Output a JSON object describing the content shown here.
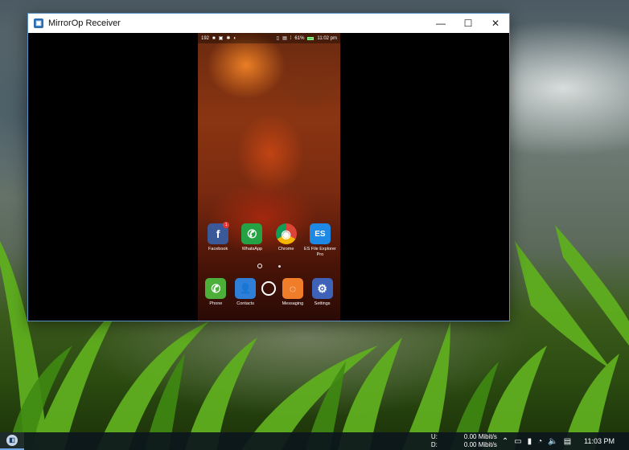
{
  "window": {
    "title": "MirrorOp Receiver",
    "controls": {
      "minimize": "—",
      "maximize": "☐",
      "close": "✕"
    }
  },
  "phone": {
    "status_bar": {
      "left_icons": [
        "192",
        "■",
        "▣",
        "✱",
        "◐"
      ],
      "right_icons": [
        "▯",
        "▤",
        "⁞"
      ],
      "battery": "61%",
      "time": "11:02 pm"
    },
    "apps": [
      {
        "label": "Facebook",
        "glyph": "f",
        "color": "#3b5998",
        "badge": "1"
      },
      {
        "label": "WhatsApp",
        "glyph": "✆",
        "color": "#25a244"
      },
      {
        "label": "Chrome",
        "glyph": "◉",
        "color": "#db4437"
      },
      {
        "label": "ES File Explorer Pro",
        "glyph": "ES",
        "color": "#1e88e5"
      }
    ],
    "dock": [
      {
        "label": "Phone",
        "glyph": "✆",
        "color": "#4caf3a"
      },
      {
        "label": "Contacts",
        "glyph": "👤",
        "color": "#2f7fd8"
      },
      {
        "label": "Messaging",
        "glyph": "◌",
        "color": "#ef7d2a"
      },
      {
        "label": "Settings",
        "glyph": "⚙",
        "color": "#3e62b8"
      }
    ]
  },
  "taskbar": {
    "app_icon_glyph": "◧",
    "network": {
      "up_label": "U:",
      "up_value": "0.00 Mibit/s",
      "down_label": "D:",
      "down_value": "0.00 Mibit/s"
    },
    "tray": {
      "chevron": "⌃",
      "battery": "▭",
      "usb": "▮",
      "wifi": "◔",
      "volume": "🔈",
      "notifications": "▤"
    },
    "clock": "11:03 PM"
  },
  "colors": {
    "window_border": "#5a8fc2",
    "taskbar_accent": "#6ea6e6"
  }
}
